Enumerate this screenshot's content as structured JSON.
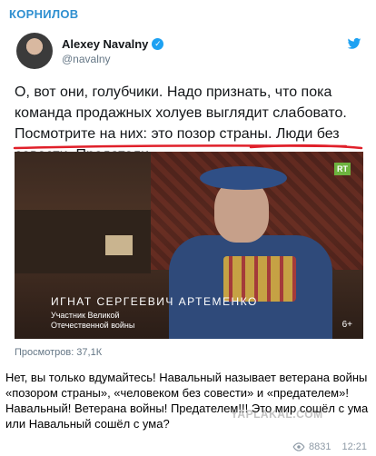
{
  "channel": {
    "name": "КОРНИЛОВ"
  },
  "tweet": {
    "author_name": "Alexey Navalny",
    "handle": "@navalny",
    "text": "О, вот они, голубчики. Надо признать, что пока команда продажных холуев выглядит слабовато. Посмотрите на них: это позор страны. Люди без совести. Предатели.",
    "video": {
      "channel_badge": "RT",
      "caption_name": "ИГНАТ СЕРГЕЕВИЧ АРТЕМЕНКО",
      "caption_role": "Участник Великой Отечественной войны",
      "age_rating": "6+"
    },
    "views": "Просмотров: 37,1К"
  },
  "message": {
    "text": "Нет, вы только вдумайтесь! Навальный называет ветерана войны «позором страны», «человеком без совести» и «предателем»! Навальный! Ветерана войны! Предателем!!! Это мир сошёл с ума или Навальный сошёл с ума?",
    "watermark": "YAPLAKAL.COM",
    "views": "8831",
    "time": "12:21"
  },
  "colors": {
    "channel": "#2e8fd0",
    "verified": "#1da1f2",
    "twitter": "#1da1f2",
    "underline": "#e0202a"
  }
}
